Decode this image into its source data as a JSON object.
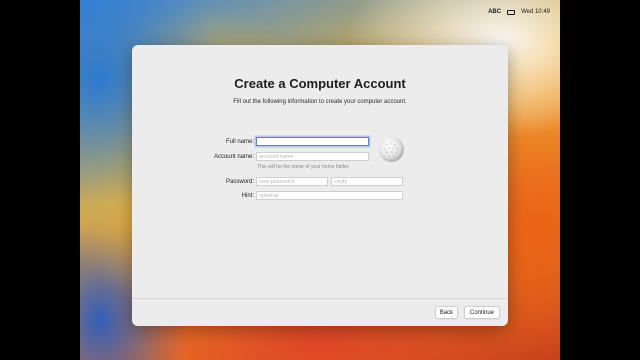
{
  "menubar": {
    "input_source": "ABC",
    "keyboard_icon": "keyboard-icon",
    "clock": "Wed 10:49"
  },
  "dialog": {
    "title": "Create a Computer Account",
    "subtitle": "Fill out the following information to create your computer account.",
    "full_name": {
      "label": "Full name:",
      "value": "",
      "placeholder": ""
    },
    "account_name": {
      "label": "Account name:",
      "value": "",
      "placeholder": "account name",
      "note": "This will be the name of your home folder."
    },
    "password": {
      "label": "Password:",
      "placeholder": "new password",
      "verify_placeholder": "verify"
    },
    "hint": {
      "label": "Hint:",
      "placeholder": "optional"
    },
    "avatar_icon": "golf-ball-icon",
    "back_label": "Back",
    "continue_label": "Continue"
  },
  "colors": {
    "focus_ring": "#4a86e8",
    "dialog_bg": "#ececec"
  }
}
